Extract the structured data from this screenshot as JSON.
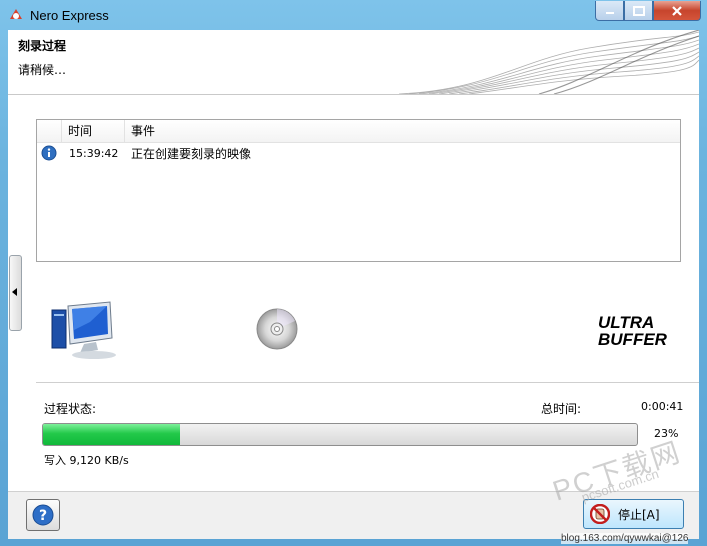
{
  "window": {
    "title": "Nero Express",
    "controls": [
      "minimize-icon",
      "maximize-icon",
      "close-icon"
    ]
  },
  "header": {
    "title": "刻录过程",
    "subtitle": "请稍候…"
  },
  "log": {
    "columns": {
      "time": "时间",
      "event": "事件"
    },
    "rows": [
      {
        "icon": "info-icon",
        "time": "15:39:42",
        "event": "正在创建要刻录的映像"
      }
    ]
  },
  "status": {
    "process_label": "过程状态:",
    "total_time_label": "总时间:",
    "total_time_value": "0:00:41",
    "progress_percent": 23,
    "progress_text": "23%",
    "write_speed": "写入 9,120 KB/s"
  },
  "footer": {
    "help_icon": "help-icon",
    "stop_label": "停止[A]"
  },
  "watermark": {
    "brand": "PC下载网",
    "domain": "pcsoft.com.cn",
    "blog": "blog.163.com/qywwkai@126"
  },
  "colors": {
    "title_bar": "#6bb3de",
    "progress_fill": "#23c94a",
    "accent": "#3c7fb1"
  }
}
